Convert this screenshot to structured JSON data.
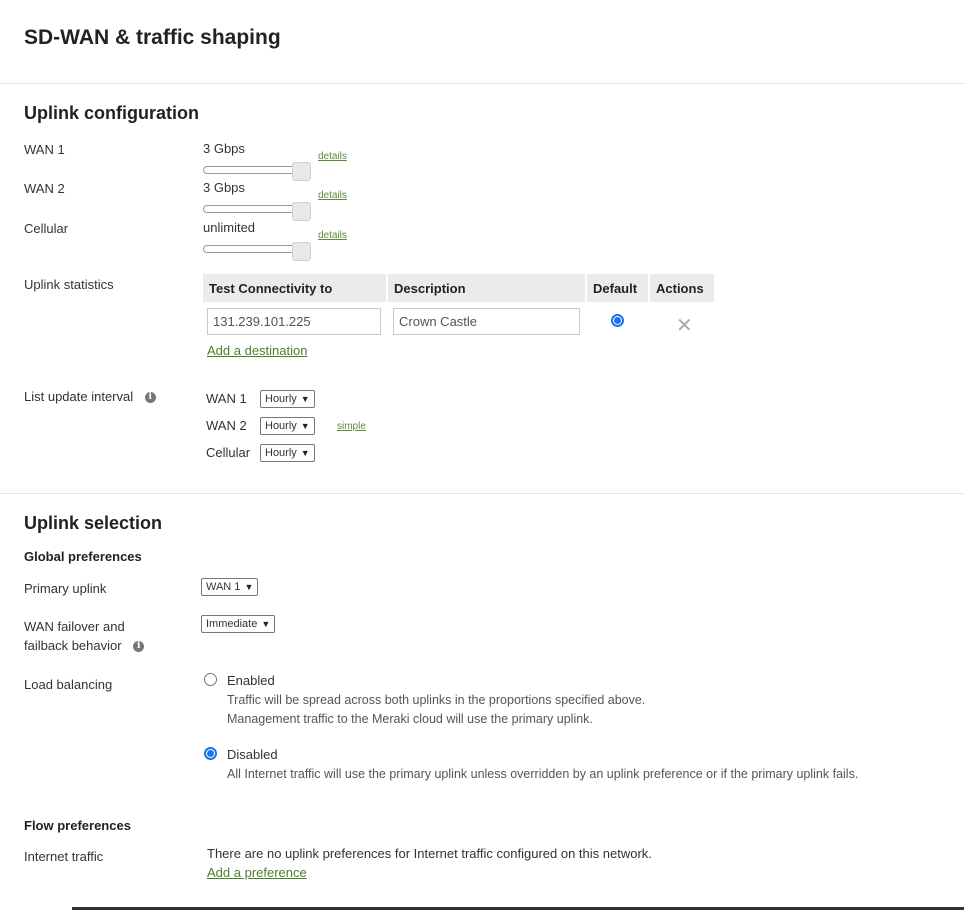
{
  "page": {
    "title": "SD-WAN & traffic shaping"
  },
  "uplink_configuration": {
    "heading": "Uplink configuration",
    "bandwidth": [
      {
        "label": "WAN 1",
        "value": "3 Gbps",
        "details_link": "details",
        "slider_level": 1.0
      },
      {
        "label": "WAN 2",
        "value": "3 Gbps",
        "details_link": "details",
        "slider_level": 1.0
      },
      {
        "label": "Cellular",
        "value": "unlimited",
        "details_link": "details",
        "slider_level": 1.0
      }
    ],
    "uplink_statistics": {
      "label": "Uplink statistics",
      "columns": [
        "Test Connectivity to",
        "Description",
        "Default",
        "Actions"
      ],
      "rows": [
        {
          "destination": "131.239.101.225",
          "description": "Crown Castle",
          "default": true
        }
      ],
      "add_link": "Add a destination"
    },
    "list_update_interval": {
      "label": "List update interval",
      "rows": [
        {
          "label": "WAN 1",
          "value": "Hourly"
        },
        {
          "label": "WAN 2",
          "value": "Hourly"
        },
        {
          "label": "Cellular",
          "value": "Hourly"
        }
      ],
      "simple_link": "simple"
    }
  },
  "uplink_selection": {
    "heading": "Uplink selection",
    "global_preferences": {
      "heading": "Global preferences",
      "primary_uplink": {
        "label": "Primary uplink",
        "value": "WAN 1"
      },
      "failover": {
        "label_line1": "WAN failover and",
        "label_line2": "failback behavior",
        "value": "Immediate"
      },
      "load_balancing": {
        "label": "Load balancing",
        "options": [
          {
            "label": "Enabled",
            "selected": false,
            "description": [
              "Traffic will be spread across both uplinks in the proportions specified above.",
              "Management traffic to the Meraki cloud will use the primary uplink."
            ]
          },
          {
            "label": "Disabled",
            "selected": true,
            "description": [
              "All Internet traffic will use the primary uplink unless overridden by an uplink preference or if the primary uplink fails."
            ]
          }
        ]
      }
    },
    "flow_preferences": {
      "heading": "Flow preferences",
      "internet_traffic": {
        "label": "Internet traffic",
        "message": "There are no uplink preferences for Internet traffic configured on this network.",
        "add_link": "Add a preference"
      }
    }
  }
}
